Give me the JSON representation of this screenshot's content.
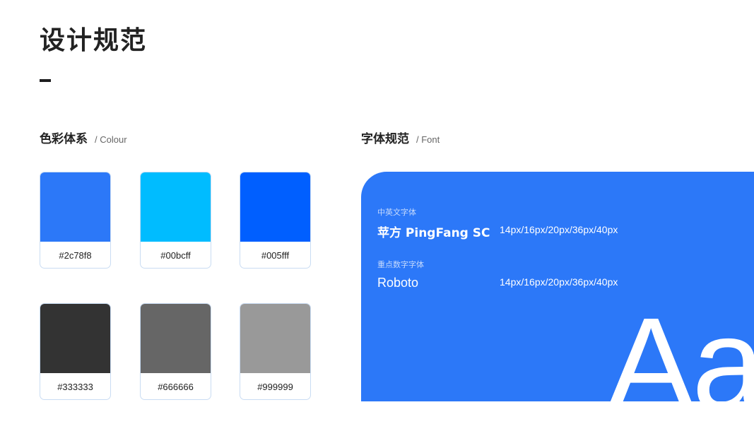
{
  "page": {
    "title": "设计规范"
  },
  "colour_section": {
    "title_cn": "色彩体系",
    "title_en": "/ Colour",
    "swatches": [
      {
        "label": "#2c78f8",
        "color": "#2c78f8"
      },
      {
        "label": "#00bcff",
        "color": "#00bcff"
      },
      {
        "label": "#005fff",
        "color": "#005fff"
      },
      {
        "label": "#333333",
        "color": "#333333"
      },
      {
        "label": "#666666",
        "color": "#666666"
      },
      {
        "label": "#999999",
        "color": "#999999"
      }
    ]
  },
  "font_section": {
    "title_cn": "字体规范",
    "title_en": "/ Font",
    "panel_color": "#2c78f8",
    "fonts": [
      {
        "caption": "中英文字体",
        "name": "苹方 PingFang SC",
        "sizes": "14px/16px/20px/36px/40px"
      },
      {
        "caption": "重点数字字体",
        "name": "Roboto",
        "sizes": "14px/16px/20px/36px/40px"
      }
    ],
    "sample": "Aa"
  }
}
